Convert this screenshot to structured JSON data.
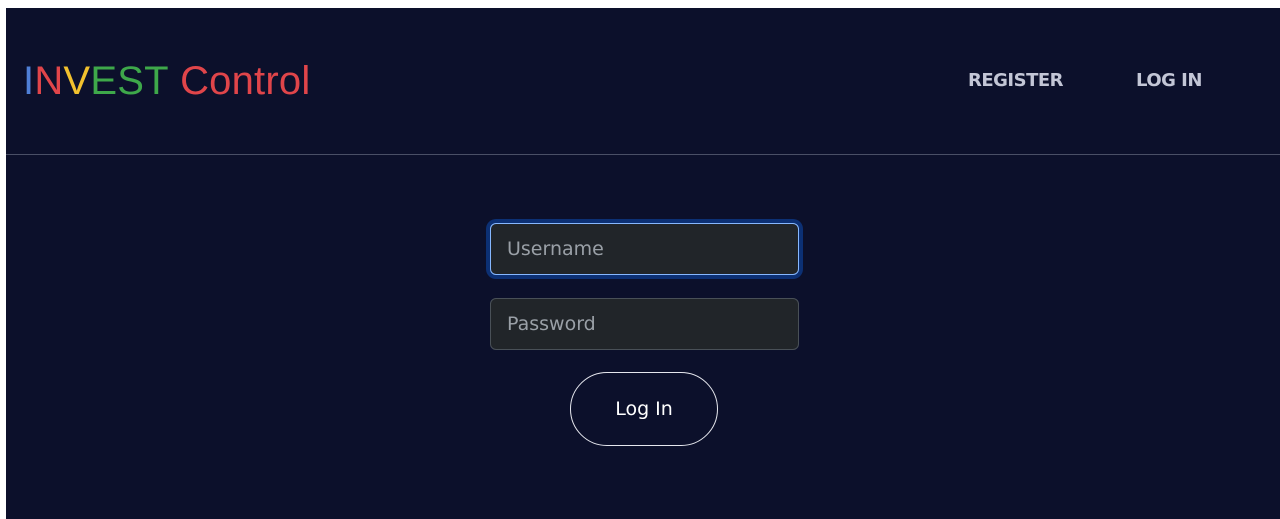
{
  "brand": {
    "letters": [
      {
        "char": "I",
        "color": "#4f7fd6"
      },
      {
        "char": "N",
        "color": "#e0454a"
      },
      {
        "char": "V",
        "color": "#f2c12e"
      },
      {
        "char": "E",
        "color": "#3ea84a"
      },
      {
        "char": "S",
        "color": "#3ea84a"
      },
      {
        "char": "T",
        "color": "#3ea84a"
      },
      {
        "char": " ",
        "color": "#e0454a"
      },
      {
        "char": "Control",
        "color": "#e0454a"
      }
    ]
  },
  "nav": {
    "register_label": "REGISTER",
    "login_label": "LOG IN"
  },
  "form": {
    "username_placeholder": "Username",
    "username_value": "",
    "password_placeholder": "Password",
    "password_value": "",
    "submit_label": "Log In"
  },
  "colors": {
    "background": "#0c102b",
    "input_background": "#212529",
    "focus_ring": "#86b7fe"
  }
}
